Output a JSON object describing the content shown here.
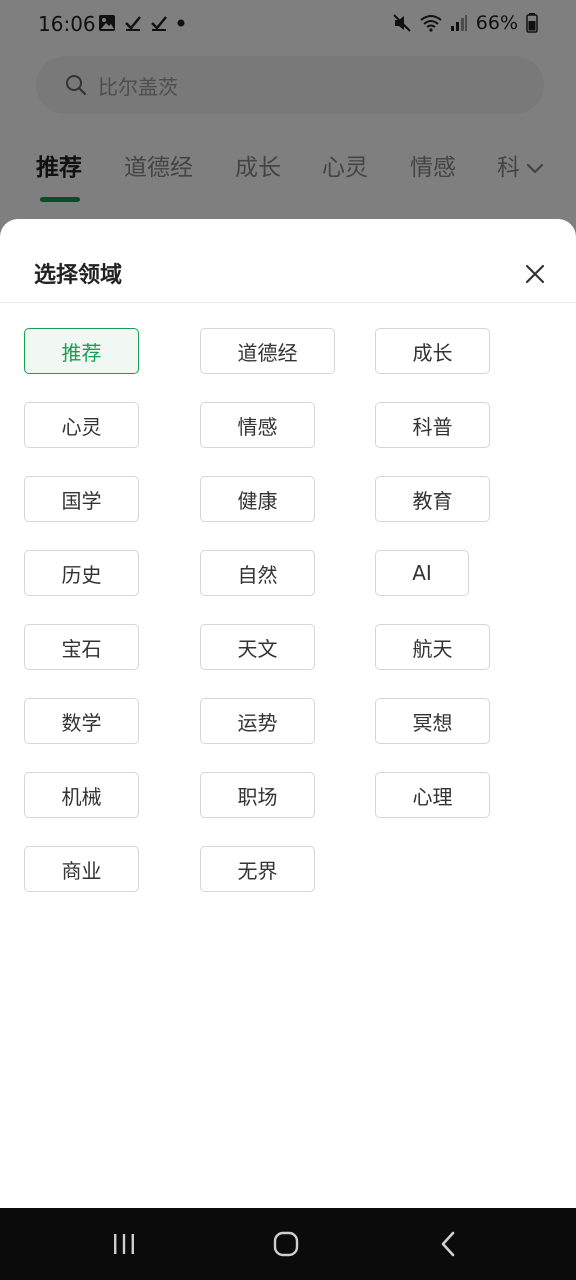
{
  "status_bar": {
    "time": "16:06",
    "battery": "66%"
  },
  "search": {
    "placeholder": "比尔盖茨"
  },
  "tabs": [
    {
      "label": "推荐"
    },
    {
      "label": "道德经"
    },
    {
      "label": "成长"
    },
    {
      "label": "心灵"
    },
    {
      "label": "情感"
    },
    {
      "label": "科"
    }
  ],
  "sheet": {
    "title": "选择领域",
    "chips": [
      {
        "label": "推荐",
        "selected": true
      },
      {
        "label": "道德经"
      },
      {
        "label": "成长"
      },
      {
        "label": "心灵"
      },
      {
        "label": "情感"
      },
      {
        "label": "科普"
      },
      {
        "label": "国学"
      },
      {
        "label": "健康"
      },
      {
        "label": "教育"
      },
      {
        "label": "历史"
      },
      {
        "label": "自然"
      },
      {
        "label": "AI"
      },
      {
        "label": "宝石"
      },
      {
        "label": "天文"
      },
      {
        "label": "航天"
      },
      {
        "label": "数学"
      },
      {
        "label": "运势"
      },
      {
        "label": "冥想"
      },
      {
        "label": "机械"
      },
      {
        "label": "职场"
      },
      {
        "label": "心理"
      },
      {
        "label": "商业"
      },
      {
        "label": "无界"
      }
    ]
  },
  "colors": {
    "accent": "#1a9d55",
    "overlay": "rgba(0,0,0,0.5)"
  },
  "icons": [
    "image-icon",
    "check-icon",
    "mute-icon",
    "wifi-icon",
    "signal-icon",
    "battery-icon",
    "search-icon",
    "chevron-down-icon",
    "close-icon",
    "recents-icon",
    "home-icon",
    "back-icon"
  ]
}
